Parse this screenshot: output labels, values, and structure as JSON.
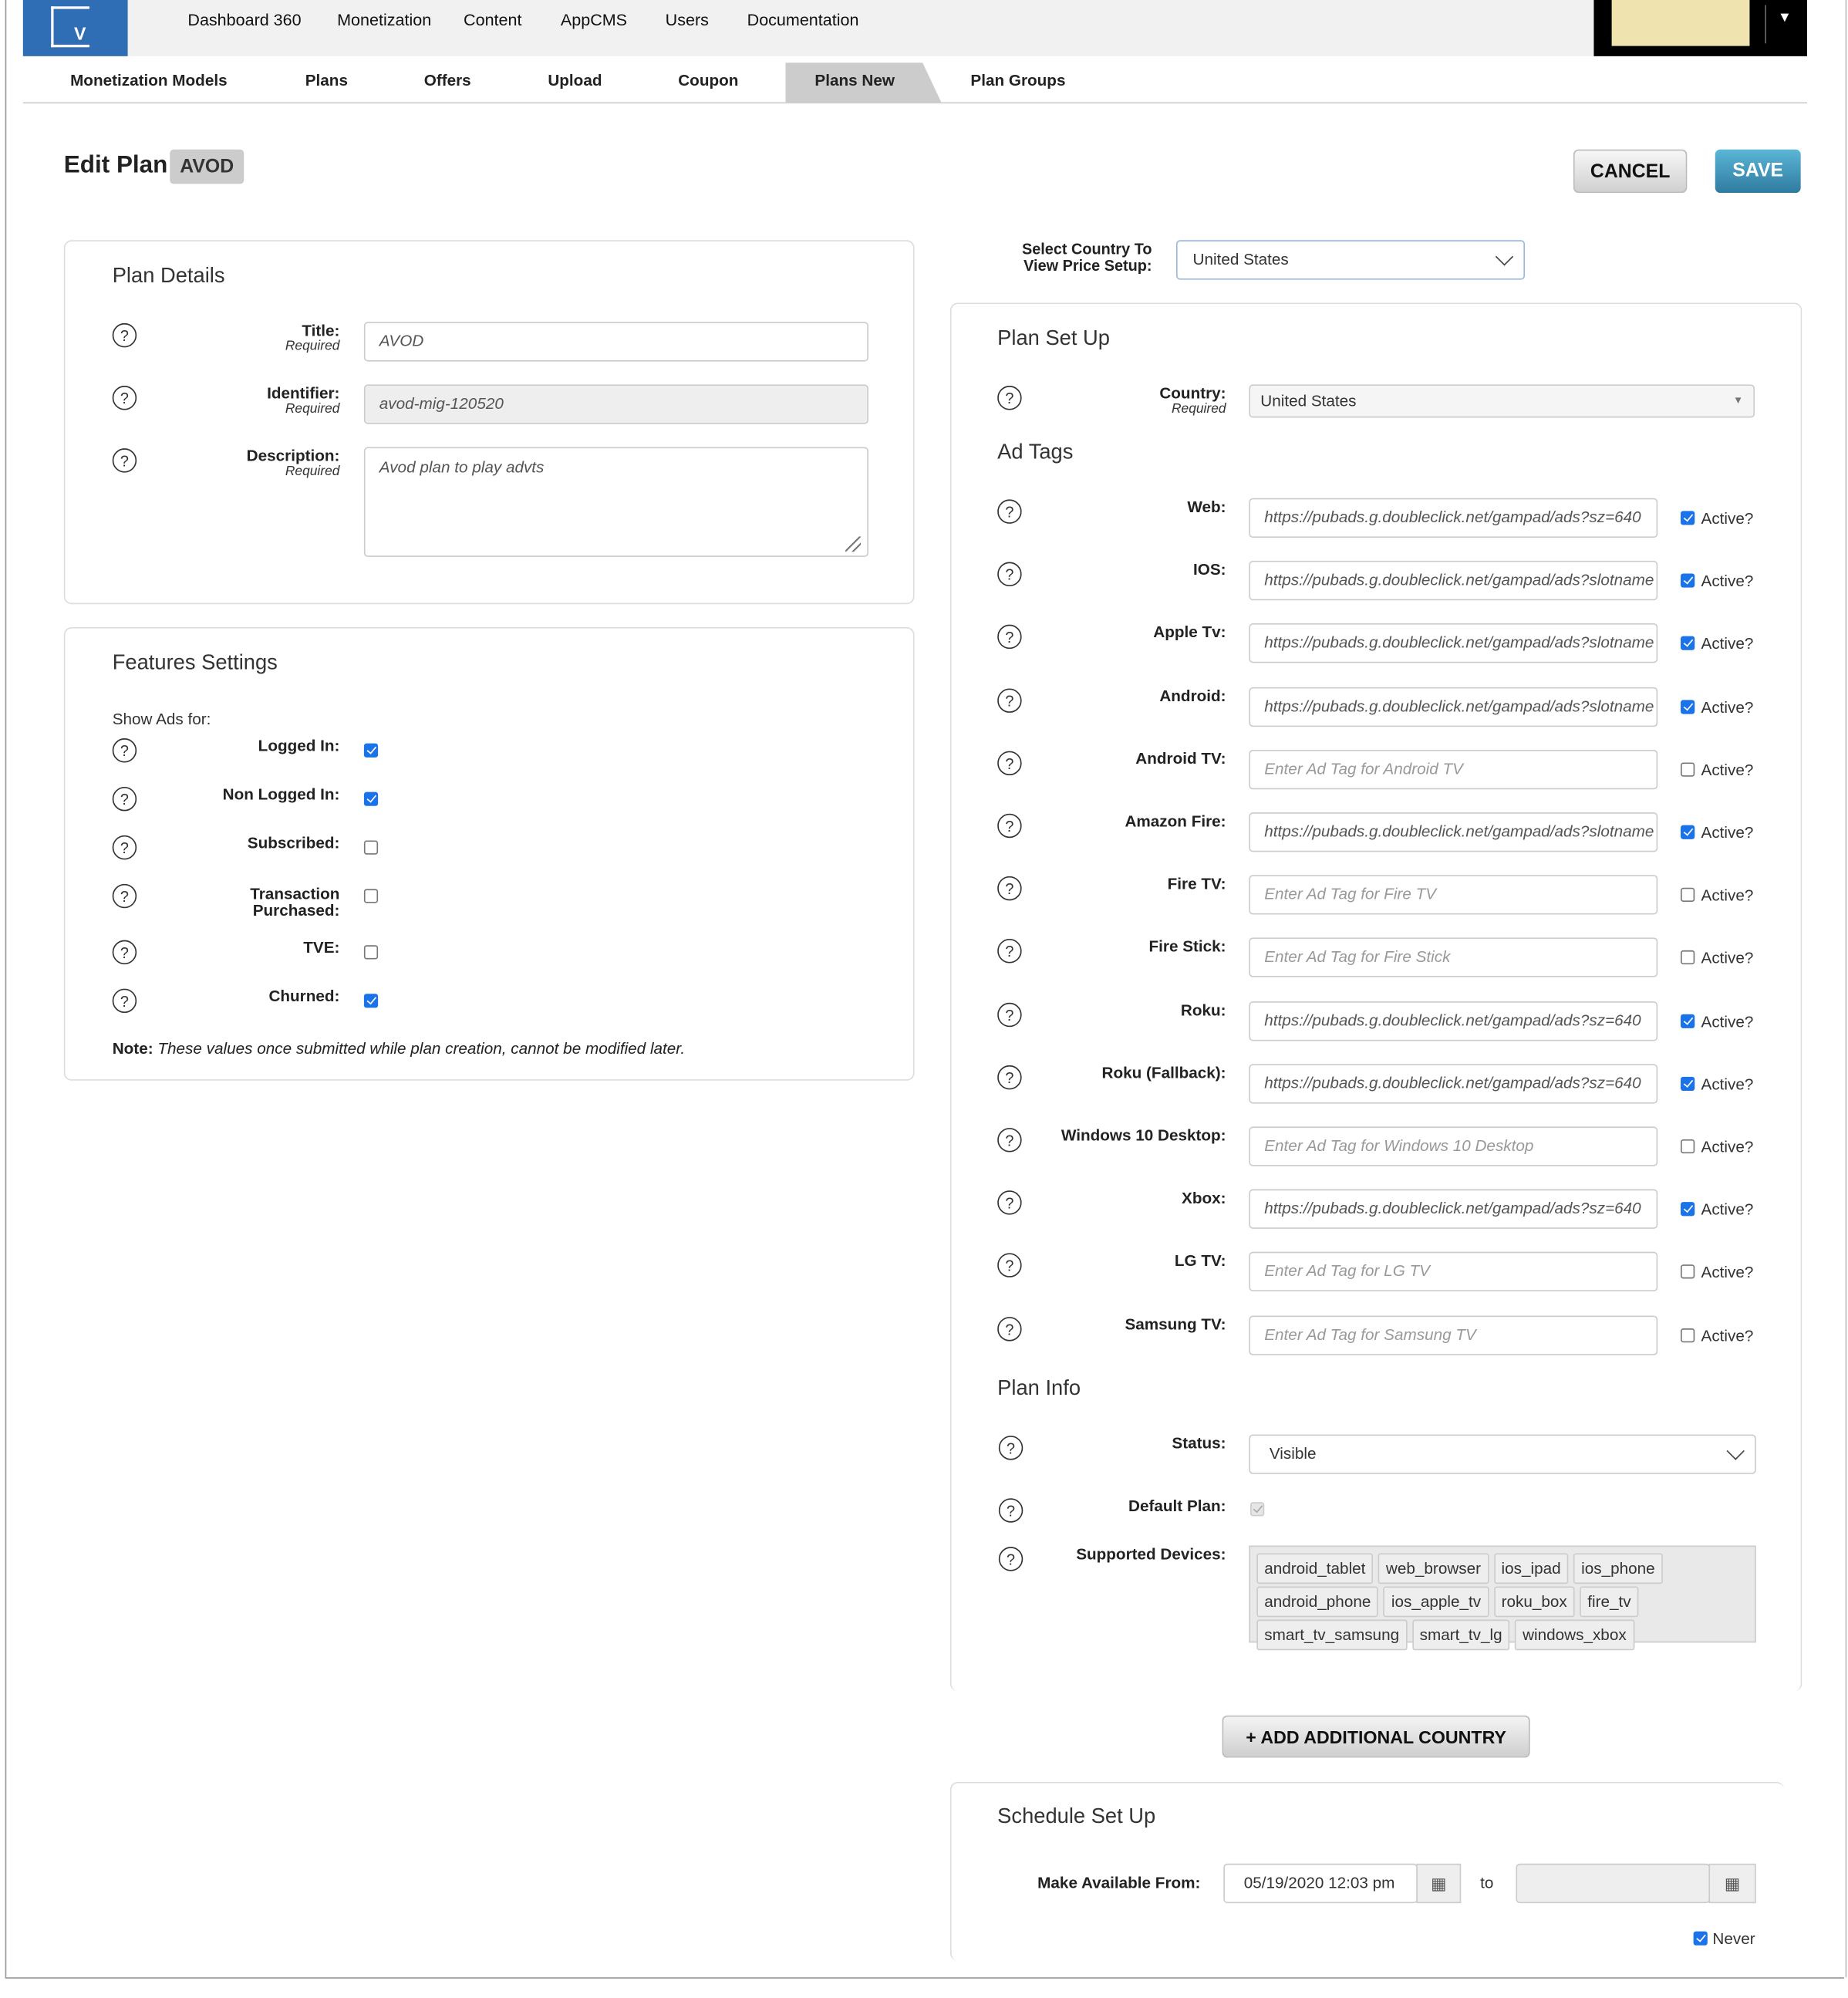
{
  "topnav": {
    "links": [
      "Dashboard 360",
      "Monetization",
      "Content",
      "AppCMS",
      "Users",
      "Documentation"
    ]
  },
  "tabs": {
    "items": [
      "Monetization Models",
      "Plans",
      "Offers",
      "Upload",
      "Coupon",
      "Plans New",
      "Plan Groups"
    ],
    "active": "Plans New"
  },
  "header": {
    "title": "Edit Plan",
    "badge": "AVOD",
    "cancel": "CANCEL",
    "save": "SAVE"
  },
  "colors": {
    "brand": "#2f6db5",
    "save": "#3a8ab3",
    "checkbox": "#1a73e8"
  },
  "plan_details": {
    "title": "Plan Details",
    "required": "Required",
    "title_label": "Title:",
    "title_value": "AVOD",
    "identifier_label": "Identifier:",
    "identifier_value": "avod-mig-120520",
    "description_label": "Description:",
    "description_value": "Avod plan to play advts"
  },
  "features": {
    "title": "Features Settings",
    "show_ads_for": "Show Ads for:",
    "items": [
      {
        "label": "Logged In:",
        "checked": true
      },
      {
        "label": "Non Logged In:",
        "checked": true
      },
      {
        "label": "Subscribed:",
        "checked": false
      },
      {
        "label": "Transaction Purchased:",
        "checked": false
      },
      {
        "label": "TVE:",
        "checked": false
      },
      {
        "label": "Churned:",
        "checked": true
      }
    ],
    "note_label": "Note:",
    "note_text": "These values once submitted while plan creation, cannot be modified later."
  },
  "country_select": {
    "label": "Select Country To View Price Setup:",
    "value": "United States"
  },
  "plan_setup": {
    "title": "Plan Set Up",
    "country_label": "Country:",
    "country_required": "Required",
    "country_value": "United States",
    "ad_tags_title": "Ad Tags",
    "active_label": "Active?",
    "ad_tags": [
      {
        "label": "Web:",
        "value": "https://pubads.g.doubleclick.net/gampad/ads?sz=640",
        "placeholder": "",
        "active": true
      },
      {
        "label": "IOS:",
        "value": "https://pubads.g.doubleclick.net/gampad/ads?slotname",
        "placeholder": "",
        "active": true
      },
      {
        "label": "Apple Tv:",
        "value": "https://pubads.g.doubleclick.net/gampad/ads?slotname",
        "placeholder": "",
        "active": true
      },
      {
        "label": "Android:",
        "value": "https://pubads.g.doubleclick.net/gampad/ads?slotname",
        "placeholder": "",
        "active": true
      },
      {
        "label": "Android TV:",
        "value": "",
        "placeholder": "Enter Ad Tag for Android TV",
        "active": false
      },
      {
        "label": "Amazon Fire:",
        "value": "https://pubads.g.doubleclick.net/gampad/ads?slotname",
        "placeholder": "",
        "active": true
      },
      {
        "label": "Fire TV:",
        "value": "",
        "placeholder": "Enter Ad Tag for Fire TV",
        "active": false
      },
      {
        "label": "Fire Stick:",
        "value": "",
        "placeholder": "Enter Ad Tag for Fire Stick",
        "active": false
      },
      {
        "label": "Roku:",
        "value": "https://pubads.g.doubleclick.net/gampad/ads?sz=640",
        "placeholder": "",
        "active": true
      },
      {
        "label": "Roku (Fallback):",
        "value": "https://pubads.g.doubleclick.net/gampad/ads?sz=640",
        "placeholder": "",
        "active": true
      },
      {
        "label": "Windows 10 Desktop:",
        "value": "",
        "placeholder": "Enter Ad Tag for Windows 10 Desktop",
        "active": false
      },
      {
        "label": "Xbox:",
        "value": "https://pubads.g.doubleclick.net/gampad/ads?sz=640",
        "placeholder": "",
        "active": true
      },
      {
        "label": "LG TV:",
        "value": "",
        "placeholder": "Enter Ad Tag for LG TV",
        "active": false
      },
      {
        "label": "Samsung TV:",
        "value": "",
        "placeholder": "Enter Ad Tag for Samsung TV",
        "active": false
      }
    ],
    "plan_info_title": "Plan Info",
    "status_label": "Status:",
    "status_value": "Visible",
    "default_plan_label": "Default Plan:",
    "default_plan_checked": true,
    "devices_label": "Supported Devices:",
    "devices": [
      "android_tablet",
      "web_browser",
      "ios_ipad",
      "ios_phone",
      "android_phone",
      "ios_apple_tv",
      "roku_box",
      "fire_tv",
      "smart_tv_samsung",
      "smart_tv_lg",
      "windows_xbox"
    ]
  },
  "add_country": "+ ADD ADDITIONAL COUNTRY",
  "schedule": {
    "title": "Schedule Set Up",
    "from_label": "Make Available From:",
    "from_value": "05/19/2020 12:03 pm",
    "to_label": "to",
    "to_value": "",
    "never_label": "Never",
    "never_checked": true
  }
}
